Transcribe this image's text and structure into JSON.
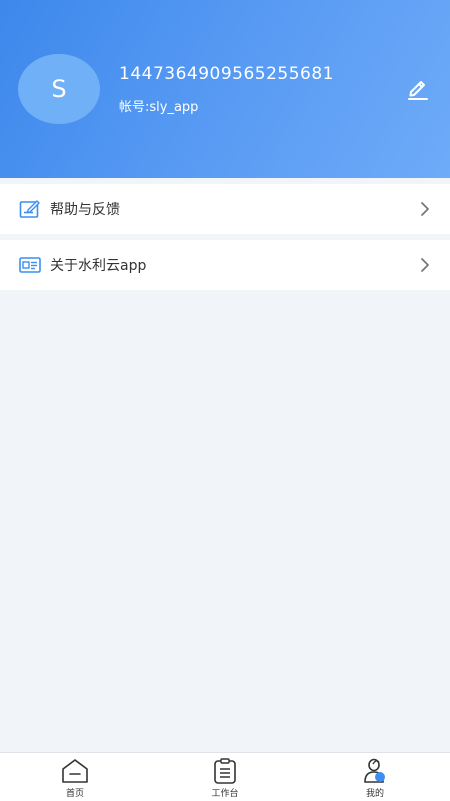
{
  "profile": {
    "avatar_letter": "S",
    "user_id": "1447364909565255681",
    "account": "帐号:sly_app"
  },
  "menu": {
    "items": [
      {
        "label": "帮助与反馈",
        "icon": "feedback-icon"
      },
      {
        "label": "关于水利云app",
        "icon": "about-icon"
      }
    ]
  },
  "tabbar": {
    "tabs": [
      {
        "label": "首页",
        "icon": "home-icon",
        "active": false
      },
      {
        "label": "工作台",
        "icon": "clipboard-icon",
        "active": false
      },
      {
        "label": "我的",
        "icon": "profile-icon",
        "active": true
      }
    ]
  },
  "colors": {
    "header_start": "#3d88ec",
    "header_end": "#6eabf8",
    "icon_blue": "#3d8ef0",
    "background": "#f1f5f9"
  }
}
